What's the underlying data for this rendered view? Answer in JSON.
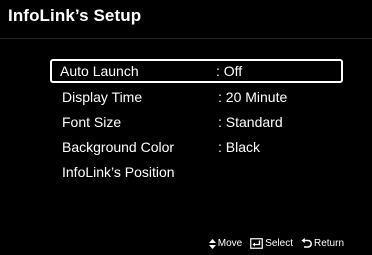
{
  "header": {
    "title": "InfoLink’s Setup"
  },
  "menu": {
    "items": [
      {
        "label": "Auto Launch",
        "value": ": Off",
        "selected": true
      },
      {
        "label": "Display Time",
        "value": ": 20 Minute",
        "selected": false
      },
      {
        "label": "Font Size",
        "value": ": Standard",
        "selected": false
      },
      {
        "label": "Background Color",
        "value": ": Black",
        "selected": false
      },
      {
        "label": "InfoLink’s Position",
        "value": "",
        "selected": false
      }
    ]
  },
  "footer": {
    "move_icon": "up-down-arrow-icon",
    "move_label": "Move",
    "select_icon": "enter-icon",
    "select_label": "Select",
    "return_icon": "return-icon",
    "return_label": "Return"
  }
}
